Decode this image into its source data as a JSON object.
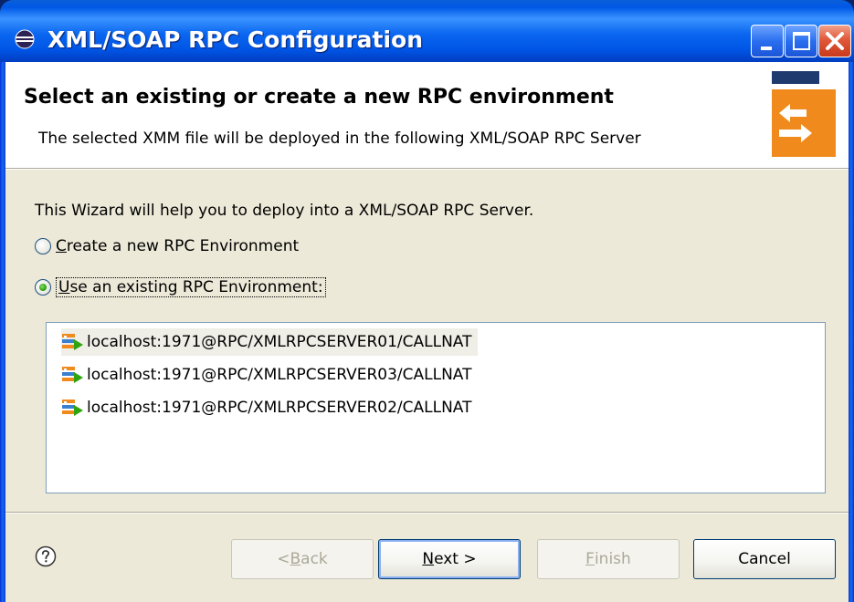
{
  "window": {
    "title": "XML/SOAP RPC Configuration"
  },
  "banner": {
    "title": "Select an existing or create a new RPC environment",
    "description": "The selected XMM file will be deployed in the following XML/SOAP RPC Server"
  },
  "body": {
    "intro": "This Wizard will help you to deploy into a XML/SOAP RPC Server.",
    "radio_create": {
      "mnemonic": "C",
      "rest": "reate a new RPC Environment",
      "checked": false
    },
    "radio_use": {
      "mnemonic": "U",
      "rest": "se an existing RPC Environment:",
      "checked": true
    }
  },
  "environments": [
    {
      "label": "localhost:1971@RPC/XMLRPCSERVER01/CALLNAT",
      "selected": true
    },
    {
      "label": "localhost:1971@RPC/XMLRPCSERVER03/CALLNAT",
      "selected": false
    },
    {
      "label": "localhost:1971@RPC/XMLRPCSERVER02/CALLNAT",
      "selected": false
    }
  ],
  "buttons": {
    "back": {
      "prefix": "< ",
      "mnemonic": "B",
      "rest": "ack",
      "enabled": false
    },
    "next": {
      "mnemonic": "N",
      "rest": "ext >",
      "enabled": true
    },
    "finish": {
      "mnemonic": "F",
      "rest": "inish",
      "enabled": false
    },
    "cancel": {
      "label": "Cancel",
      "enabled": true
    }
  },
  "icons": {
    "window_icon": "eclipse-icon",
    "banner_image": "wizard-arrows-icon",
    "help": "help-icon",
    "environment": "rpc-environment-icon"
  },
  "colors": {
    "titlebar": "#0058e6",
    "dialog_bg": "#ece9d8",
    "banner_orange": "#f08a1c",
    "close_button": "#e0593a"
  }
}
